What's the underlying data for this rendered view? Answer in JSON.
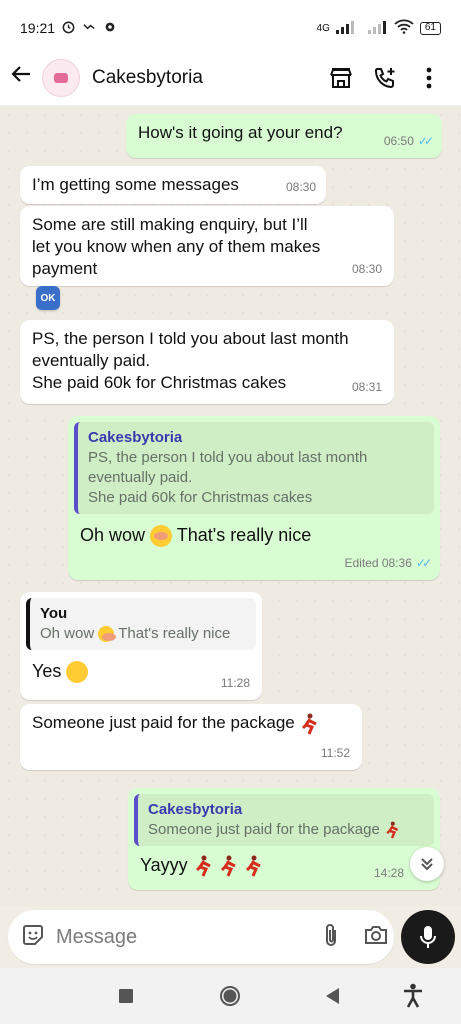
{
  "status_bar": {
    "time": "19:21",
    "network": "4G",
    "battery": "61"
  },
  "header": {
    "title": "Cakesbytoria"
  },
  "messages": [
    {
      "dir": "out",
      "text": "How's it going at your end?",
      "time": "06:50"
    },
    {
      "dir": "in",
      "text": "I’m getting some messages",
      "time": "08:30"
    },
    {
      "dir": "in",
      "lines": [
        "Some are still making enquiry, but I’ll",
        "let you know when any of them makes",
        "payment"
      ],
      "time": "08:30",
      "reaction": "OK"
    },
    {
      "dir": "in",
      "lines": [
        "PS, the person I told you about last month",
        "eventually paid.",
        "She paid 60k for Christmas cakes"
      ],
      "time": "08:31"
    },
    {
      "dir": "out",
      "quote": {
        "author": "Cakesbytoria",
        "lines": [
          "PS, the person I told you about last month",
          "eventually paid.",
          "She paid 60k for Christmas cakes"
        ]
      },
      "text_before": "Oh wow",
      "text_after": "That's really nice",
      "time": "Edited 08:36"
    },
    {
      "dir": "in",
      "quote": {
        "author": "You",
        "text_before": "Oh wow",
        "text_after": "That's really nice"
      },
      "text": "Yes",
      "time": "11:28"
    },
    {
      "dir": "in",
      "text": "Someone just paid for the package",
      "time": "11:52"
    },
    {
      "dir": "out",
      "quote": {
        "author": "Cakesbytoria",
        "text": "Someone just paid for the package"
      },
      "text": "Yayyy",
      "time": "14:28"
    }
  ],
  "composer": {
    "placeholder": "Message"
  },
  "icons": {
    "back": "arrow-left-icon",
    "shop": "storefront-icon",
    "add_call": "add-call-icon",
    "menu": "more-vert-icon",
    "sticker": "sticker-icon",
    "attach": "paperclip-icon",
    "camera": "camera-icon",
    "mic": "mic-icon",
    "scroll": "double-chevron-down-icon"
  },
  "colors": {
    "outgoing_bubble": "#d9fdd3",
    "incoming_bubble": "#ffffff",
    "read_ticks": "#53bdeb",
    "quote_bar": "#5b4fc9"
  }
}
